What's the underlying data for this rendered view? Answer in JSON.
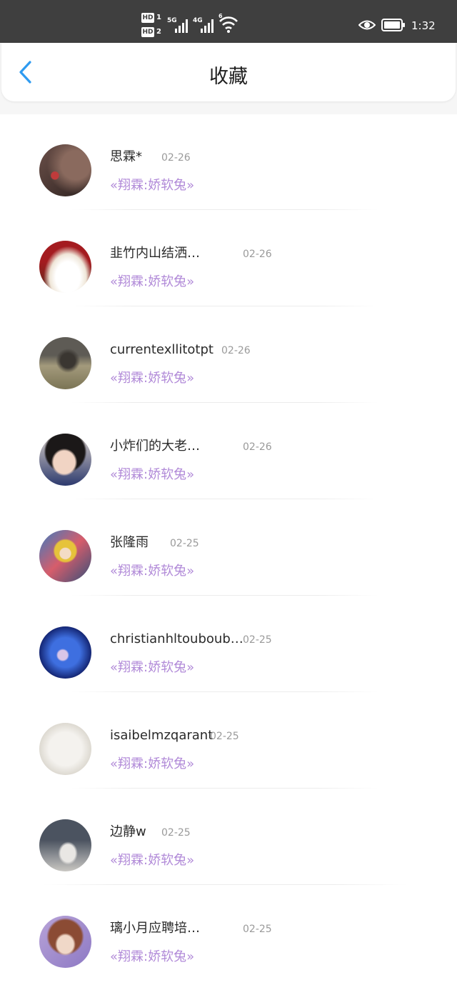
{
  "status_bar": {
    "hd1": "HD",
    "hd1_num": "1",
    "hd2": "HD",
    "hd2_num": "2",
    "net1": "5G",
    "net2": "4G",
    "wifi_num": "6",
    "time": "1:32"
  },
  "header": {
    "title": "收藏",
    "back_icon": "chevron-left-icon",
    "accent_color": "#2f9bf0"
  },
  "subtitle_color": "#b18ad8",
  "items": [
    {
      "name": "思霖*",
      "date": "02-26",
      "subtitle": "«翔霖:娇软兔»",
      "avatar": "dark-flower-photo"
    },
    {
      "name": "韭竹内山结洒…",
      "date": "02-26",
      "subtitle": "«翔霖:娇软兔»",
      "avatar": "cream-cake-photo"
    },
    {
      "name": "currentexllitotpt",
      "date": "02-26",
      "subtitle": "«翔霖:娇软兔»",
      "avatar": "person-in-field-photo"
    },
    {
      "name": "小炸们的大老…",
      "date": "02-26",
      "subtitle": "«翔霖:娇软兔»",
      "avatar": "boy-portrait-photo"
    },
    {
      "name": "张隆雨",
      "date": "02-25",
      "subtitle": "«翔霖:娇软兔»",
      "avatar": "anime-girl-illustration"
    },
    {
      "name": "christianhltouboub…",
      "date": "02-25",
      "subtitle": "«翔霖:娇软兔»",
      "avatar": "blue-night-dancer"
    },
    {
      "name": "isaibelmzqarant",
      "date": "02-25",
      "subtitle": "«翔霖:娇软兔»",
      "avatar": "white-cat-photo"
    },
    {
      "name": "边静w",
      "date": "02-25",
      "subtitle": "«翔霖:娇软兔»",
      "avatar": "street-figure-photo"
    },
    {
      "name": "璃小月应聘培…",
      "date": "02-25",
      "subtitle": "«翔霖:娇软兔»",
      "avatar": "anime-woman-illustration"
    }
  ]
}
